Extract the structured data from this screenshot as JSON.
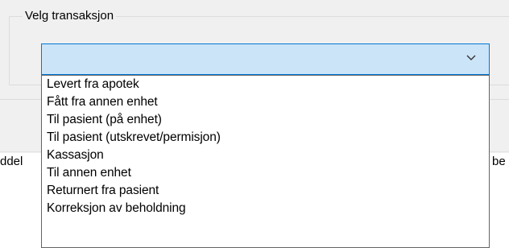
{
  "group": {
    "title": "Velg transaksjon"
  },
  "combo": {
    "selected_value": "",
    "arrow_icon": "chevron-down-icon"
  },
  "dropdown": {
    "items": [
      "Levert fra apotek",
      "Fått fra annen enhet",
      "Til pasient (på enhet)",
      "Til pasient (utskrevet/permisjon)",
      "Kassasjon",
      "Til annen enhet",
      "Returnert fra pasient",
      "Korreksjon av beholdning"
    ]
  },
  "background_labels": {
    "left_clipped": "ddel",
    "right_clipped": "be"
  },
  "colors": {
    "panel_background": "#f0f0f0",
    "combo_selected_background": "#cce4f7",
    "combo_focus_border": "#0078d7",
    "dropdown_border": "#646464"
  }
}
